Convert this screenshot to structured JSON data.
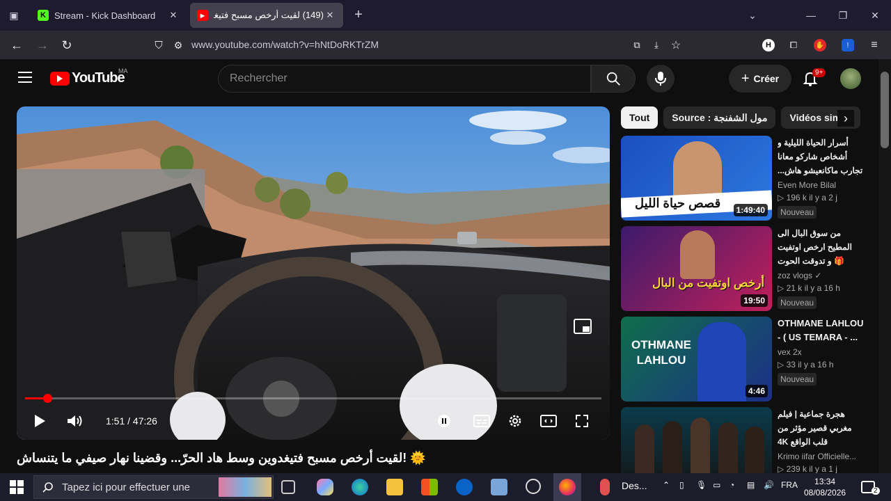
{
  "browser": {
    "tabs": [
      {
        "title": "Stream - Kick Dashboard",
        "favicon": "kick",
        "active": false
      },
      {
        "title": "(149) لقيت أرخص مسبح فتيغدوي",
        "favicon": "youtube",
        "active": true
      }
    ],
    "url": "www.youtube.com/watch?v=hNtDoRKTrZM",
    "notif_icon_letter": "H"
  },
  "youtube": {
    "logo_text": "YouTube",
    "country": "MA",
    "search_placeholder": "Rechercher",
    "create_label": "Créer",
    "create_plus": "+",
    "notif_badge": "9+"
  },
  "player": {
    "time": "1:51 / 47:26",
    "progress": 0.039,
    "title": "🌞 !لقيت أرخص مسبح فتيغدوين وسط هاد الحرّ... وقضينا نهار صيفي ما يتنساش"
  },
  "chips": [
    "Tout",
    "Source : مول الشفنجة",
    "Vidéos simila"
  ],
  "recommendations": [
    {
      "title": "أسرار الحياة الليلية و أشخاص شاركو معانا تجارب ماكانعيشو هاش...",
      "channel": "Even More Bilal",
      "views": "▷ 196 k  il y a 2 j",
      "badge": "Nouveau",
      "duration": "1:49:40",
      "thumb_text": "قصص حياة الليل",
      "rtl": true
    },
    {
      "title": "من سوق البال الى المطيح ارخص اوتفيت 🎁 و تدوقت الحوت فريت 🐟",
      "channel": "zoz vlogs ✓",
      "views": "▷ 21 k  il y a 16 h",
      "badge": "Nouveau",
      "duration": "19:50",
      "thumb_text": "أرخص اوتفيت من البال",
      "rtl": true
    },
    {
      "title": "OTHMANE LAHLOU - ( US TEMARA - ...",
      "channel": "vex 2x",
      "views": "▷ 33  il y a 16 h",
      "badge": "Nouveau",
      "duration": "4:46",
      "thumb_text": "OTHMANE LAHLOU",
      "rtl": false
    },
    {
      "title": "هجرة جماعية | فيلم مغربي قصير مؤثر من قلب الواقع 4K",
      "channel": "Krimo iifar Officielle...",
      "views": "▷ 239 k  il y a 1 j",
      "badge": "",
      "duration": "",
      "thumb_text": "",
      "rtl": true
    }
  ],
  "taskbar": {
    "search_placeholder": "Tapez ici pour effectuer une",
    "app_label": "Des...",
    "lang": "FRA",
    "time": "13:34",
    "date": "08/08/2026",
    "notif_count": "2"
  },
  "colors": {
    "yt_red": "#ff0000",
    "bg": "#0f0f0f",
    "tab_bar": "#1f1b2e"
  }
}
